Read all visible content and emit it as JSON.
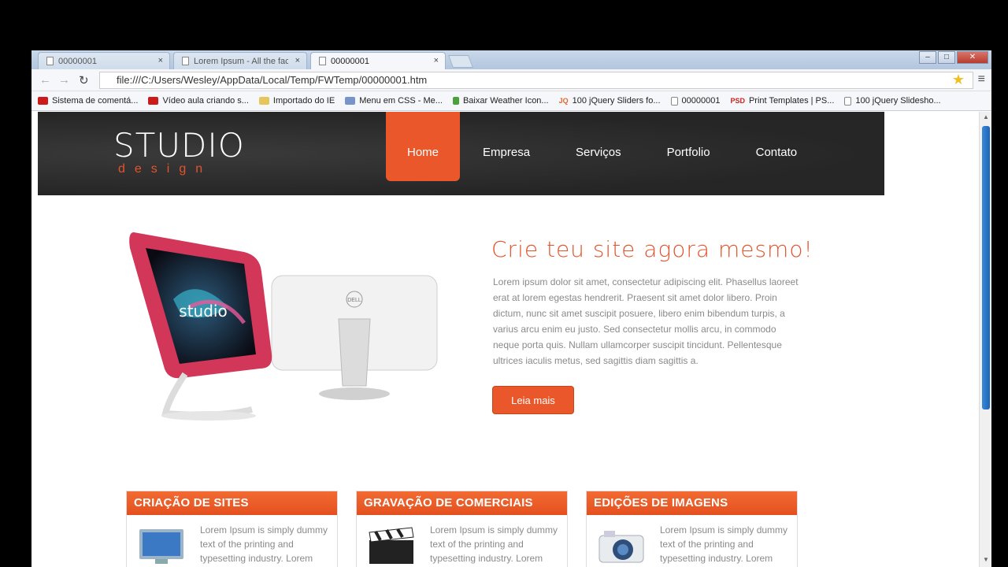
{
  "browser": {
    "tabs": [
      {
        "title": "00000001"
      },
      {
        "title": "Lorem Ipsum - All the fact"
      },
      {
        "title": "00000001"
      }
    ],
    "close_glyph": "×",
    "address": "file:///C:/Users/Wesley/AppData/Local/Temp/FWTemp/00000001.htm",
    "bookmarks": [
      {
        "label": "Sistema de comentá...",
        "icon": "youtube-icon"
      },
      {
        "label": "Vídeo aula criando s...",
        "icon": "youtube-icon"
      },
      {
        "label": "Importado do IE",
        "icon": "folder-icon"
      },
      {
        "label": "Menu em CSS - Me...",
        "icon": "cloud-icon"
      },
      {
        "label": "Baixar Weather Icon...",
        "icon": "download-icon"
      },
      {
        "label": "100 jQuery Sliders fo...",
        "icon": "jquery-icon",
        "glyph": "JQ"
      },
      {
        "label": "00000001",
        "icon": "page-icon"
      },
      {
        "label": "Print Templates | PS...",
        "icon": "psd-icon",
        "glyph": "PSD"
      },
      {
        "label": "100 jQuery Slidesho...",
        "icon": "page-icon"
      }
    ]
  },
  "site": {
    "logo_main": "STUDIO",
    "logo_sub": "design",
    "nav": [
      "Home",
      "Empresa",
      "Serviços",
      "Portfolio",
      "Contato"
    ],
    "hero": {
      "image_word": "studio",
      "brand_word": "DELL",
      "title": "Crie teu site agora mesmo!",
      "text": "Lorem ipsum dolor sit amet, consectetur adipiscing elit. Phasellus laoreet erat at lorem egestas hendrerit. Praesent sit amet dolor libero. Proin dictum, nunc sit amet suscipit posuere, libero enim bibendum turpis, a varius arcu enim eu justo. Sed consectetur mollis arcu, in commodo neque porta quis. Nullam ullamcorper suscipit tincidunt. Pellentesque ultrices iaculis metus, sed sagittis diam sagittis a.",
      "button": "Leia mais"
    },
    "boxes": [
      {
        "title": "CRIAÇÃO DE SITES",
        "text": "Lorem Ipsum is simply dummy text of the printing and typesetting industry. Lorem",
        "icon": "monitor-icon"
      },
      {
        "title": "GRAVAÇÃO DE COMERCIAIS",
        "text": "Lorem Ipsum is simply dummy text of the printing and typesetting industry. Lorem",
        "icon": "clapperboard-icon"
      },
      {
        "title": "EDIÇÕES DE IMAGENS",
        "text": "Lorem Ipsum is simply dummy text of the printing and typesetting industry. Lorem",
        "icon": "camera-icon"
      }
    ]
  },
  "colors": {
    "accent": "#e9572a",
    "header_bg": "#2a2a2a"
  }
}
